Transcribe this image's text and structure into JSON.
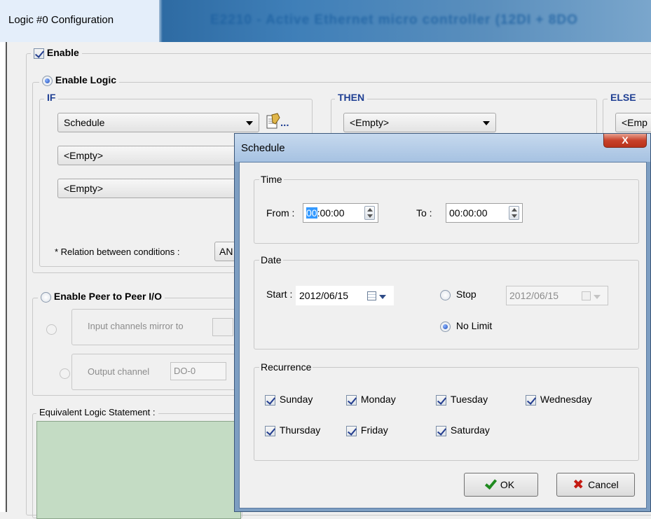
{
  "main_window": {
    "title": "Logic #0 Configuration",
    "background_title": "E2210 - Active Ethernet micro controller (12DI + 8DO",
    "enable_label": "Enable",
    "enable_logic_label": "Enable Logic",
    "if_label": "IF",
    "then_label": "THEN",
    "else_label": "ELSE",
    "if_conditions": [
      "Schedule",
      "<Empty>",
      "<Empty>"
    ],
    "then_action": "<Empty>",
    "else_action": "<Emp",
    "relation_label": "* Relation between conditions :",
    "relation_value": "AN",
    "peer_label": "Enable Peer to Peer I/O",
    "input_mirror_label": "Input channels mirror to",
    "output_channel_label": "Output channel",
    "output_channel_value": "DO-0",
    "equivalent_label": "Equivalent Logic Statement :",
    "ellipsis": "..."
  },
  "dialog": {
    "title": "Schedule",
    "close_glyph": "X",
    "time": {
      "legend": "Time",
      "from_label": "From :",
      "from_selected": "00",
      "from_rest": ":00:00",
      "to_label": "To :",
      "to_value": "00:00:00"
    },
    "date": {
      "legend": "Date",
      "start_label": "Start :",
      "start_value": "2012/06/15",
      "stop_label": "Stop",
      "stop_value": "2012/06/15",
      "no_limit_label": "No Limit"
    },
    "recurrence": {
      "legend": "Recurrence",
      "days": [
        "Sunday",
        "Monday",
        "Tuesday",
        "Wednesday",
        "Thursday",
        "Friday",
        "Saturday"
      ]
    },
    "ok_label": "OK",
    "cancel_label": "Cancel"
  },
  "colors": {
    "accent_blue": "#1f3f93",
    "equivalent_box": "#c4dcc4",
    "dialog_frame": "#7d9ec2",
    "close_button": "#c8412a"
  },
  "icons": [
    "config-document-icon",
    "calendar-icon",
    "checkmark-icon",
    "cancel-x-icon",
    "close-icon"
  ]
}
